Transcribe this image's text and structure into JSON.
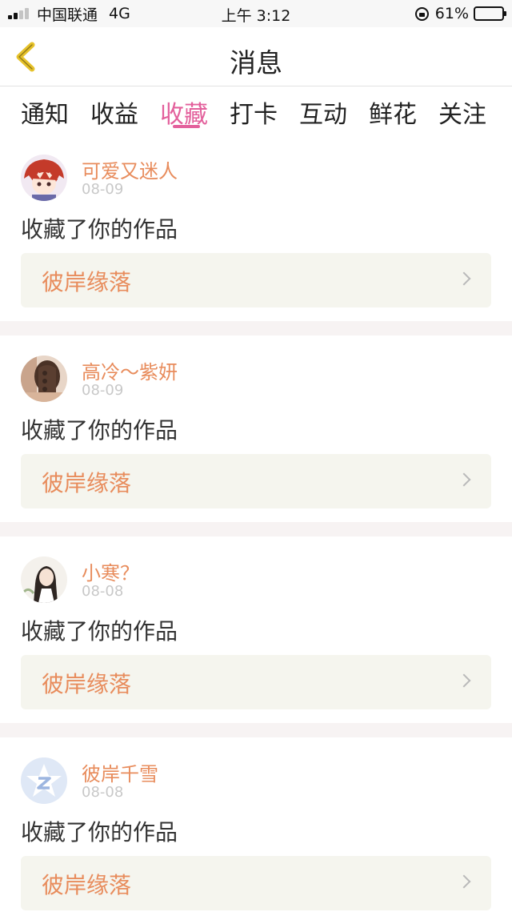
{
  "status_bar": {
    "carrier": "中国联通",
    "network": "4G",
    "time": "上午 3:12",
    "battery": "61%",
    "battery_level": 0.61,
    "signal_bars": 2
  },
  "header": {
    "title": "消息",
    "back_icon": "chevron-left-icon"
  },
  "tabs": [
    {
      "label": "通知",
      "active": false
    },
    {
      "label": "收益",
      "active": false
    },
    {
      "label": "收藏",
      "active": true
    },
    {
      "label": "打卡",
      "active": false
    },
    {
      "label": "互动",
      "active": false
    },
    {
      "label": "鲜花",
      "active": false
    },
    {
      "label": "关注",
      "active": false
    }
  ],
  "colors": {
    "accent": "#e3609c",
    "username": "#e88c5c",
    "back_arrow": "#e6c22a"
  },
  "messages": [
    {
      "username": "可爱又迷人",
      "date": "08-09",
      "action": "收藏了你的作品",
      "work_title": "彼岸缘落"
    },
    {
      "username": "高冷～紫妍",
      "date": "08-09",
      "action": "收藏了你的作品",
      "work_title": "彼岸缘落"
    },
    {
      "username": "小寒？",
      "date": "08-08",
      "action": "收藏了你的作品",
      "work_title": "彼岸缘落"
    },
    {
      "username": "彼岸千雪",
      "date": "08-08",
      "action": "收藏了你的作品",
      "work_title": "彼岸缘落"
    }
  ]
}
